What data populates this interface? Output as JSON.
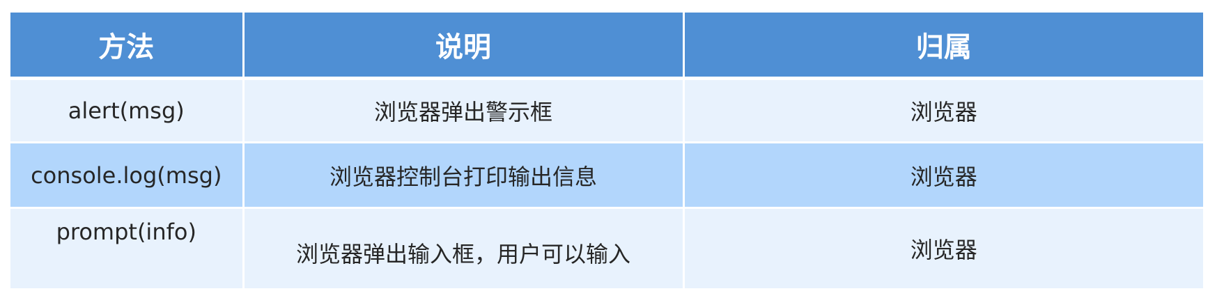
{
  "table": {
    "headers": [
      "方法",
      "说明",
      "归属"
    ],
    "rows": [
      {
        "method": "alert(msg)",
        "description": "浏览器弹出警示框",
        "owner": "浏览器"
      },
      {
        "method": "console.log(msg)",
        "description": "浏览器控制台打印输出信息",
        "owner": "浏览器"
      },
      {
        "method": "prompt(info)",
        "description": "浏览器弹出输入框，用户可以输入",
        "owner": "浏览器"
      }
    ],
    "colors": {
      "header_bg": "#4f8fd4",
      "row_light": "#e8f2fd",
      "row_highlight": "#b2d6fc"
    }
  }
}
